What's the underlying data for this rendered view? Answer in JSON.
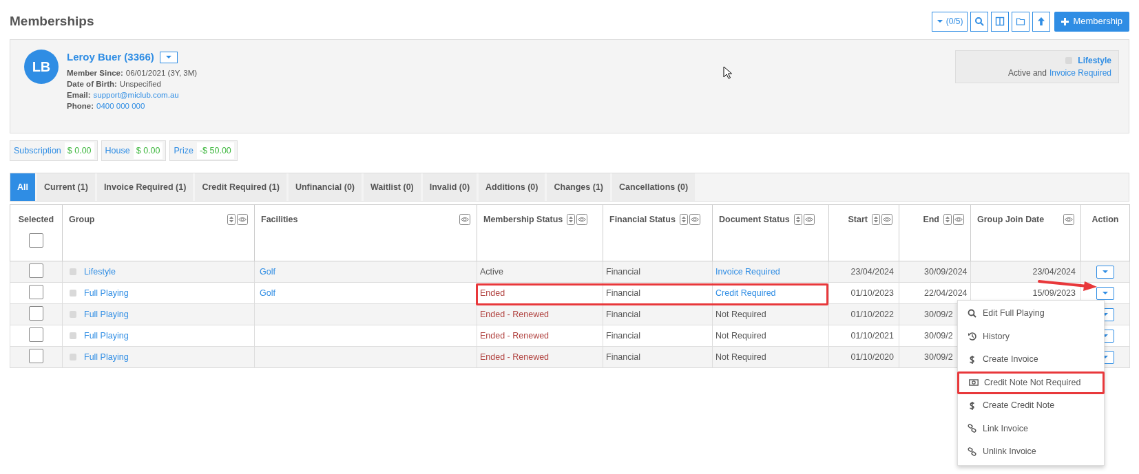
{
  "page": {
    "title": "Memberships"
  },
  "toolbar": {
    "filter_label": "(0/5)",
    "add_label": "Membership"
  },
  "member": {
    "initials": "LB",
    "name": "Leroy Buer (3366)",
    "fields": [
      {
        "label": "Member Since:",
        "value": "06/01/2021 (3Y, 3M)",
        "kind": "text"
      },
      {
        "label": "Date of Birth:",
        "value": "Unspecified",
        "kind": "text"
      },
      {
        "label": "Email:",
        "value": "support@miclub.com.au",
        "kind": "link"
      },
      {
        "label": "Phone:",
        "value": "0400 000 000",
        "kind": "link"
      }
    ],
    "summary": {
      "group": "Lifestyle",
      "status_text": "Active and",
      "status_link": "Invoice Required"
    }
  },
  "balances": [
    {
      "label": "Subscription",
      "amount": "$ 0.00"
    },
    {
      "label": "House",
      "amount": "$ 0.00"
    },
    {
      "label": "Prize",
      "amount": "-$ 50.00"
    }
  ],
  "tabs": [
    {
      "label": "All",
      "selected": true
    },
    {
      "label": "Current (1)",
      "selected": false
    },
    {
      "label": "Invoice Required (1)",
      "selected": false
    },
    {
      "label": "Credit Required (1)",
      "selected": false
    },
    {
      "label": "Unfinancial (0)",
      "selected": false
    },
    {
      "label": "Waitlist (0)",
      "selected": false
    },
    {
      "label": "Invalid (0)",
      "selected": false
    },
    {
      "label": "Additions (0)",
      "selected": false
    },
    {
      "label": "Changes (1)",
      "selected": false
    },
    {
      "label": "Cancellations (0)",
      "selected": false
    }
  ],
  "table": {
    "columns": [
      {
        "label": "Selected",
        "kind": "select"
      },
      {
        "label": "Group",
        "kind": "text",
        "sortable": true,
        "hideable": true
      },
      {
        "label": "Facilities",
        "kind": "text",
        "sortable": false,
        "hideable": true
      },
      {
        "label": "Membership Status",
        "kind": "text",
        "sortable": true,
        "hideable": true
      },
      {
        "label": "Financial Status",
        "kind": "text",
        "sortable": true,
        "hideable": true
      },
      {
        "label": "Document Status",
        "kind": "text",
        "sortable": true,
        "hideable": true
      },
      {
        "label": "Start",
        "kind": "date",
        "sortable": true,
        "hideable": true
      },
      {
        "label": "End",
        "kind": "date",
        "sortable": true,
        "hideable": true
      },
      {
        "label": "Group Join Date",
        "kind": "date",
        "sortable": false,
        "hideable": true
      },
      {
        "label": "Action",
        "kind": "action"
      }
    ],
    "select_all_checked": false,
    "rows": [
      {
        "checked": false,
        "group": "Lifestyle",
        "facilities": "Golf",
        "membership_status": "Active",
        "ended": false,
        "financial_status": "Financial",
        "document_status": "Invoice Required",
        "document_link": true,
        "start": "23/04/2024",
        "end": "30/09/2024",
        "join_date": "23/04/2024",
        "annotated": false
      },
      {
        "checked": false,
        "group": "Full Playing",
        "facilities": "Golf",
        "membership_status": "Ended",
        "ended": true,
        "financial_status": "Financial",
        "document_status": "Credit Required",
        "document_link": true,
        "start": "01/10/2023",
        "end": "22/04/2024",
        "join_date": "15/09/2023",
        "annotated": true
      },
      {
        "checked": false,
        "group": "Full Playing",
        "membership_status": "Ended - Renewed",
        "ended": true,
        "financial_status": "Financial",
        "document_status": "Not Required",
        "document_link": false,
        "start": "01/10/2022",
        "end": "30/09/2",
        "annotated": false
      },
      {
        "checked": false,
        "group": "Full Playing",
        "membership_status": "Ended - Renewed",
        "ended": true,
        "financial_status": "Financial",
        "document_status": "Not Required",
        "document_link": false,
        "start": "01/10/2021",
        "end": "30/09/2",
        "annotated": false
      },
      {
        "checked": false,
        "group": "Full Playing",
        "membership_status": "Ended - Renewed",
        "ended": true,
        "financial_status": "Financial",
        "document_status": "Not Required",
        "document_link": false,
        "start": "01/10/2020",
        "end": "30/09/2",
        "annotated": false
      }
    ]
  },
  "action_menu": {
    "items": [
      {
        "label": "Edit Full Playing",
        "highlighted": false
      },
      {
        "label": "History",
        "highlighted": false
      },
      {
        "label": "Create Invoice",
        "highlighted": false
      },
      {
        "label": "Credit Note Not Required",
        "highlighted": true
      },
      {
        "label": "Create Credit Note",
        "highlighted": false
      },
      {
        "label": "Link Invoice",
        "highlighted": false
      },
      {
        "label": "Unlink Invoice",
        "highlighted": false
      }
    ]
  }
}
